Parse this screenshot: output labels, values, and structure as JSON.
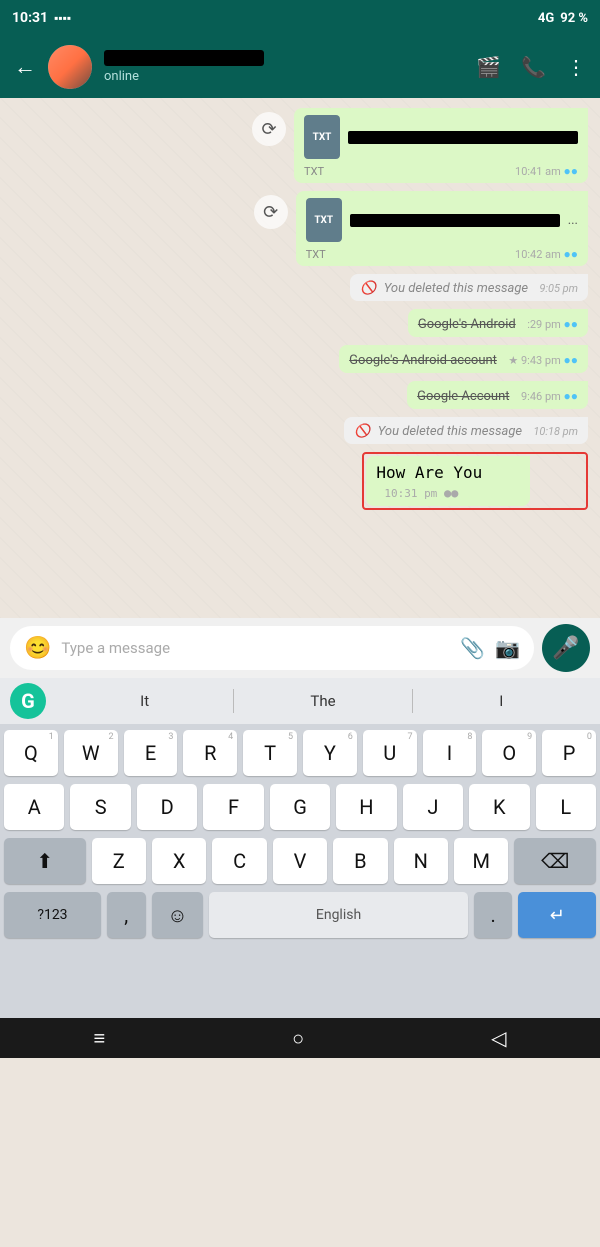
{
  "status_bar": {
    "time": "10:31",
    "signal": "4G",
    "battery": "92 %"
  },
  "header": {
    "contact_status": "online",
    "video_icon": "📹",
    "phone_icon": "📞",
    "more_icon": "⋮"
  },
  "messages": [
    {
      "id": 1,
      "type": "sent_file",
      "file_type": "TXT",
      "time": "10:41 am",
      "ticks": "●●",
      "ticks_color": "blue",
      "has_forward": true
    },
    {
      "id": 2,
      "type": "sent_file",
      "file_type": "TXT",
      "time": "10:42 am",
      "ticks": "●●",
      "ticks_color": "blue",
      "has_forward": true
    },
    {
      "id": 3,
      "type": "sent_deleted",
      "text": "You deleted this message",
      "time": "9:05 pm"
    },
    {
      "id": 4,
      "type": "sent_strikethrough",
      "text": "Google's Android",
      "time": ":29 pm",
      "ticks": "●●",
      "ticks_color": "blue"
    },
    {
      "id": 5,
      "type": "sent_strikethrough",
      "text": "Google's Android account",
      "extra": "★",
      "time": "9:43 pm",
      "ticks": "●●",
      "ticks_color": "blue"
    },
    {
      "id": 6,
      "type": "sent_strikethrough",
      "text": "Google Account",
      "time": "9:46 pm",
      "ticks": "●●",
      "ticks_color": "blue"
    },
    {
      "id": 7,
      "type": "sent_deleted",
      "text": "You deleted this message",
      "time": "10:18 pm"
    },
    {
      "id": 8,
      "type": "sent_highlighted",
      "text": "How Are You",
      "time": "10:31 pm",
      "ticks": "●●",
      "ticks_color": "grey"
    }
  ],
  "input_bar": {
    "placeholder": "Type a message",
    "emoji_icon": "😊",
    "attach_icon": "📎",
    "camera_icon": "📷",
    "mic_icon": "🎤"
  },
  "keyboard": {
    "suggestions": [
      "It",
      "The",
      "I"
    ],
    "grammarly_letter": "G",
    "rows": [
      [
        "Q",
        "W",
        "E",
        "R",
        "T",
        "Y",
        "U",
        "I",
        "O",
        "P"
      ],
      [
        "A",
        "S",
        "D",
        "F",
        "G",
        "H",
        "J",
        "K",
        "L"
      ],
      [
        "Z",
        "X",
        "C",
        "V",
        "B",
        "N",
        "M"
      ]
    ],
    "num_hints": [
      "1",
      "2",
      "3",
      "4",
      "5",
      "6",
      "7",
      "8",
      "9",
      "0"
    ],
    "special_left": "?123",
    "comma": ",",
    "emoji_key": "☺",
    "space_label": "English",
    "period": ".",
    "enter_icon": "↵"
  },
  "bottom_nav": {
    "menu_icon": "≡",
    "home_icon": "○",
    "back_icon": "◁"
  }
}
